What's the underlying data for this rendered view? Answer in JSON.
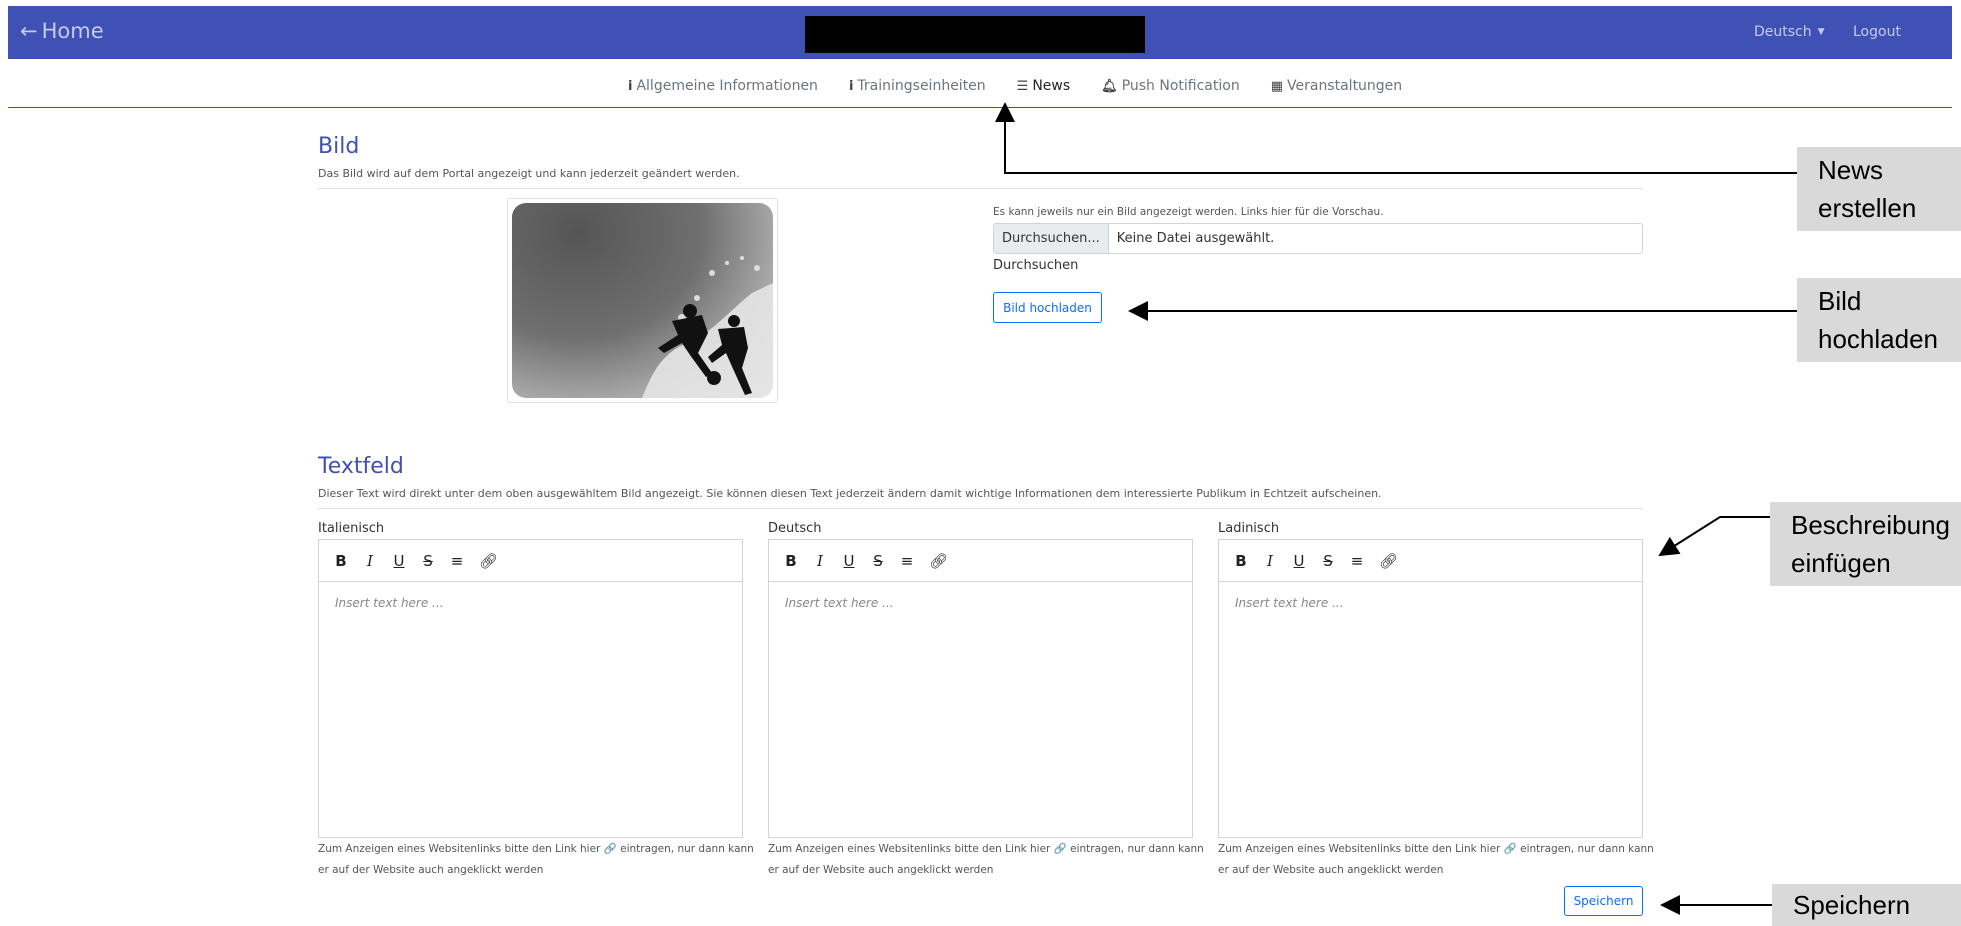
{
  "header": {
    "home_label": "Home",
    "language": "Deutsch",
    "logout": "Logout",
    "brand_color": "#3f51b5"
  },
  "tabs": [
    {
      "label": "Allgemeine Informationen",
      "icon": "info-icon"
    },
    {
      "label": "Trainingseinheiten",
      "icon": "info-icon"
    },
    {
      "label": "News",
      "icon": "list-icon",
      "active": true
    },
    {
      "label": "Push Notification",
      "icon": "bell-icon"
    },
    {
      "label": "Veranstaltungen",
      "icon": "calendar-icon"
    }
  ],
  "bild": {
    "title": "Bild",
    "subtitle": "Das Bild wird auf dem Portal angezeigt und kann jederzeit geändert werden.",
    "file_hint": "Es kann jeweils nur ein Bild angezeigt werden. Links hier für die Vorschau.",
    "browse_button": "Durchsuchen...",
    "file_status": "Keine Datei ausgewählt.",
    "browse_text": "Durchsuchen",
    "upload_button": "Bild hochladen"
  },
  "textfeld": {
    "title": "Textfeld",
    "subtitle": "Dieser Text wird direkt unter dem oben ausgewähltem Bild angezeigt. Sie können diesen Text jederzeit ändern damit wichtige Informationen dem interessierte Publikum in Echtzeit aufscheinen.",
    "placeholder": "Insert text here ...",
    "hint": "Zum Anzeigen eines Websitenlinks bitte den Link hier 🔗 eintragen, nur dann kann er auf der Website auch angeklickt werden",
    "editors": [
      {
        "label": "Italienisch"
      },
      {
        "label": "Deutsch"
      },
      {
        "label": "Ladinisch"
      }
    ],
    "toolbar": [
      "B",
      "I",
      "U",
      "S"
    ],
    "save_button": "Speichern"
  },
  "annotations": {
    "news": "News erstellen",
    "upload": "Bild hochladen",
    "description": "Beschreibung einfügen",
    "save": "Speichern"
  }
}
